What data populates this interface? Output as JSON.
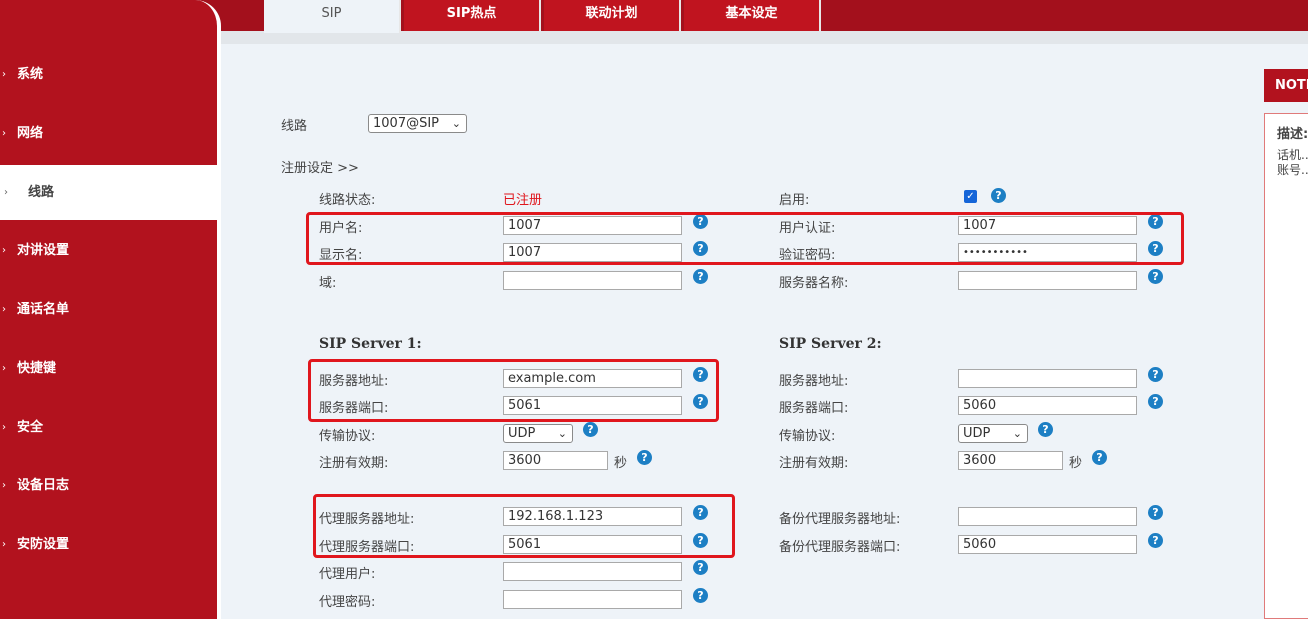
{
  "tabs": [
    "SIP",
    "SIP热点",
    "联动计划",
    "基本设定"
  ],
  "sidebar": {
    "items": [
      {
        "label": "系统",
        "active": false
      },
      {
        "label": "网络",
        "active": false
      },
      {
        "label": "线路",
        "active": true
      },
      {
        "label": "对讲设置",
        "active": false
      },
      {
        "label": "通话名单",
        "active": false
      },
      {
        "label": "快捷键",
        "active": false
      },
      {
        "label": "安全",
        "active": false
      },
      {
        "label": "设备日志",
        "active": false
      },
      {
        "label": "安防设置",
        "active": false
      }
    ],
    "chevron": "›"
  },
  "line": {
    "label": "线路",
    "selected": "1007@SIP"
  },
  "reg_settings": "注册设定 >>",
  "help_glyph": "?",
  "check_glyph": "✓",
  "dropdown_arrow": "⌄",
  "fields": {
    "line_status": {
      "label": "线路状态:",
      "value": "已注册",
      "value_color": "#e0161d"
    },
    "enable": {
      "label": "启用:",
      "checked": true
    },
    "username": {
      "label": "用户名:",
      "value": "1007"
    },
    "auth_user": {
      "label": "用户认证:",
      "value": "1007"
    },
    "display_name": {
      "label": "显示名:",
      "value": "1007"
    },
    "auth_password": {
      "label": "验证密码:",
      "value": "•••••••••••"
    },
    "domain": {
      "label": "域:",
      "value": ""
    },
    "server_name": {
      "label": "服务器名称:",
      "value": ""
    }
  },
  "server1": {
    "title": "SIP Server 1:",
    "address_label": "服务器地址:",
    "address": "example.com",
    "port_label": "服务器端口:",
    "port": "5061",
    "transport_label": "传输协议:",
    "transport": "UDP",
    "expiry_label": "注册有效期:",
    "expiry": "3600",
    "unit": "秒"
  },
  "server2": {
    "title": "SIP Server 2:",
    "address_label": "服务器地址:",
    "address": "",
    "port_label": "服务器端口:",
    "port": "5060",
    "transport_label": "传输协议:",
    "transport": "UDP",
    "expiry_label": "注册有效期:",
    "expiry": "3600",
    "unit": "秒"
  },
  "proxy": {
    "address_label": "代理服务器地址:",
    "address": "192.168.1.123",
    "port_label": "代理服务器端口:",
    "port": "5061",
    "user_label": "代理用户:",
    "user": "",
    "password_label": "代理密码:",
    "password": ""
  },
  "backup_proxy": {
    "address_label": "备份代理服务器地址:",
    "address": "",
    "port_label": "备份代理服务器端口:",
    "port": "5060"
  },
  "notice": {
    "title": "NOTI",
    "desc_label": "描述:",
    "line1": "话机...",
    "line2": "账号..."
  },
  "colors": {
    "brand_red": "#b2121e",
    "highlight_red": "#e0161d",
    "help_blue": "#1d7fc4"
  }
}
